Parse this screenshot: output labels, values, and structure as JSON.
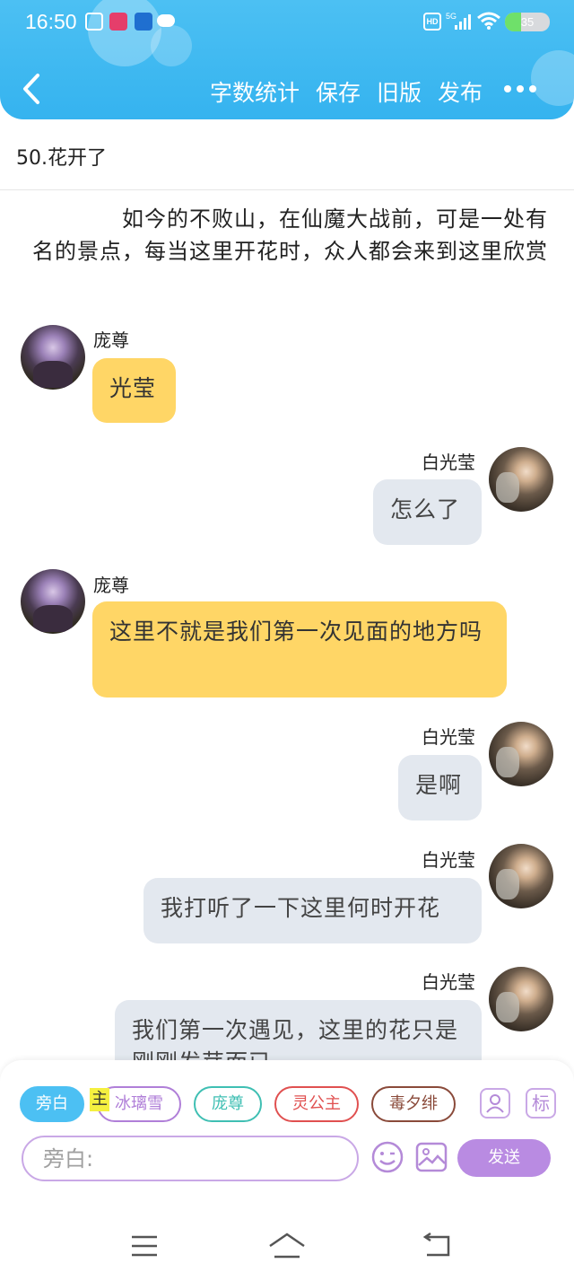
{
  "status_bar": {
    "time": "16:50",
    "battery": "35",
    "battery_level": 0.35,
    "hd_label": "HD",
    "network_label": "5G"
  },
  "nav": {
    "back_icon": "chevron-left-icon",
    "actions": [
      "字数统计",
      "保存",
      "旧版",
      "发布"
    ],
    "more_icon": "more-horizontal-icon"
  },
  "chapter": {
    "title": "50.花开了"
  },
  "narration": "如今的不败山，在仙魔大战前，可是一处有名的景点，每当这里开花时，众人都会来到这里欣赏",
  "messages": [
    {
      "speaker": "庞尊",
      "side": "left",
      "text": "光莹"
    },
    {
      "speaker": "白光莹",
      "side": "right",
      "text": "怎么了"
    },
    {
      "speaker": "庞尊",
      "side": "left",
      "text": "这里不就是我们第一次见面的地方吗"
    },
    {
      "speaker": "白光莹",
      "side": "right",
      "text": "是啊"
    },
    {
      "speaker": "白光莹",
      "side": "right",
      "text": "我打听了一下这里何时开花"
    },
    {
      "speaker": "白光莹",
      "side": "right",
      "text": "我们第一次遇见，这里的花只是刚刚发芽而已"
    }
  ],
  "characters": {
    "narrator": "旁白",
    "main_badge": "主",
    "list": [
      "冰璃雪",
      "庞尊",
      "灵公主",
      "毒夕绯"
    ]
  },
  "tools": {
    "role_icon": "person-card-icon",
    "mark_label": "标"
  },
  "input": {
    "placeholder": "旁白:",
    "emoji_icon": "emoji-icon",
    "image_icon": "image-icon",
    "send_label": "发送"
  },
  "system_nav": [
    "menu-icon",
    "home-icon",
    "back-icon"
  ],
  "colors": {
    "header": "#35b3ef",
    "left_bubble": "#ffd666",
    "right_bubble": "#e3e8ef",
    "send_button": "#b98be2"
  }
}
